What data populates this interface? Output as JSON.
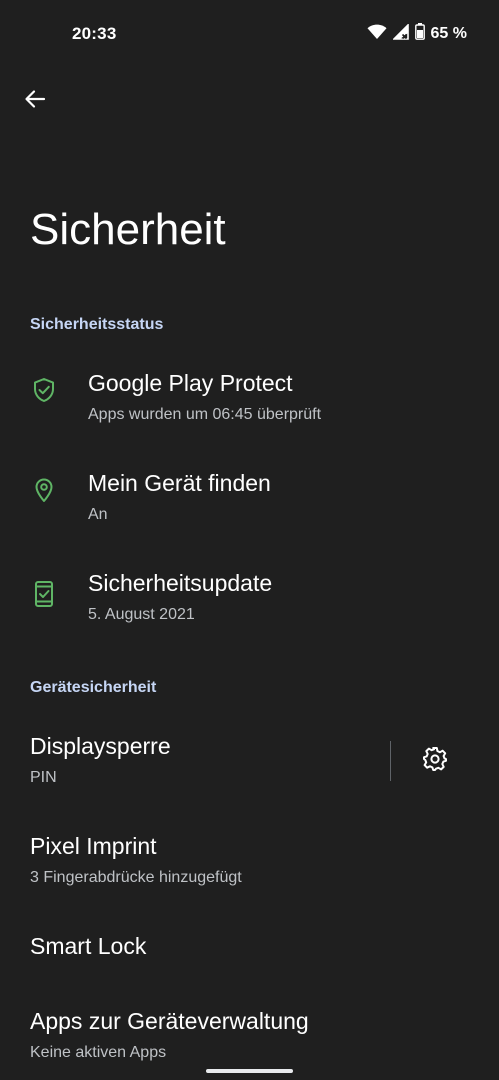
{
  "status_bar": {
    "time": "20:33",
    "battery_percent": "65 %",
    "icons": [
      "wifi-icon",
      "no-signal-icon",
      "battery-icon"
    ]
  },
  "nav": {
    "back_icon": "arrow-back-icon"
  },
  "page_title": "Sicherheit",
  "sections": {
    "security_status": {
      "header": "Sicherheitsstatus",
      "items": [
        {
          "title": "Google Play Protect",
          "subtitle": "Apps wurden um 06:45 überprüft",
          "icon": "shield-check-icon"
        },
        {
          "title": "Mein Gerät finden",
          "subtitle": "An",
          "icon": "location-pin-icon"
        },
        {
          "title": "Sicherheitsupdate",
          "subtitle": "5. August 2021",
          "icon": "phone-check-icon"
        }
      ]
    },
    "device_security": {
      "header": "Gerätesicherheit",
      "items": [
        {
          "title": "Displaysperre",
          "subtitle": "PIN",
          "icon": "gear-icon"
        },
        {
          "title": "Pixel Imprint",
          "subtitle": "3 Fingerabdrücke hinzugefügt"
        },
        {
          "title": "Smart Lock",
          "subtitle": ""
        },
        {
          "title": "Apps zur Geräteverwaltung",
          "subtitle": "Keine aktiven Apps"
        }
      ]
    }
  },
  "colors": {
    "background": "#1f1f1f",
    "accent_green": "#5fb565",
    "section_header": "#c6d6f5",
    "text_primary": "#ffffff",
    "text_secondary": "#bfc2c6"
  }
}
